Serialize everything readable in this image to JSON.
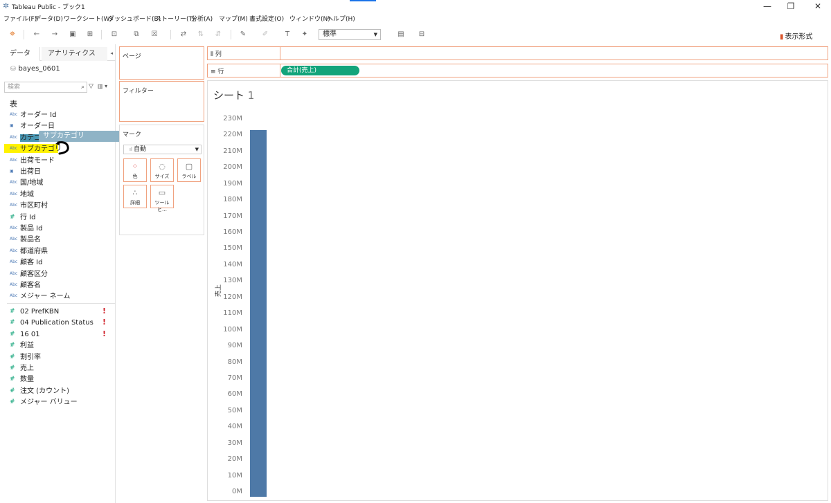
{
  "window": {
    "title": "Tableau Public - ブック1",
    "controls": [
      "—",
      "❐",
      "✕"
    ]
  },
  "menu": [
    "ファイル(F)",
    "データ(D)",
    "ワークシート(W)",
    "ダッシュボード(B)",
    "ストーリー(T)",
    "分析(A)",
    "マップ(M)",
    "書式設定(O)",
    "ウィンドウ(N)",
    "ヘルプ(H)"
  ],
  "toolbar": {
    "fit_value": "標準",
    "show_me_label": "表示形式"
  },
  "data_pane": {
    "tab_data": "データ",
    "tab_analytics": "アナリティクス",
    "datasource": "bayes_0601",
    "search_placeholder": "検索",
    "section_title": "表",
    "dimensions": [
      {
        "type": "Abc",
        "label": "オーダー Id"
      },
      {
        "type": "date",
        "label": "オーダー日"
      },
      {
        "type": "Abc",
        "label": "カテゴリ"
      },
      {
        "type": "Abc",
        "label": "サブカテゴリ"
      },
      {
        "type": "Abc",
        "label": "出荷モード"
      },
      {
        "type": "date",
        "label": "出荷日"
      },
      {
        "type": "Abc",
        "label": "国/地域"
      },
      {
        "type": "Abc",
        "label": "地域"
      },
      {
        "type": "Abc",
        "label": "市区町村"
      },
      {
        "type": "#",
        "label": "行 Id"
      },
      {
        "type": "Abc",
        "label": "製品 Id"
      },
      {
        "type": "Abc",
        "label": "製品名"
      },
      {
        "type": "Abc",
        "label": "都道府県"
      },
      {
        "type": "Abc",
        "label": "顧客 Id"
      },
      {
        "type": "Abc",
        "label": "顧客区分"
      },
      {
        "type": "Abc",
        "label": "顧客名"
      },
      {
        "type": "Abc",
        "label": "メジャー ネーム"
      }
    ],
    "measures": [
      {
        "type": "#",
        "label": "02 PrefKBN",
        "warning": true
      },
      {
        "type": "#",
        "label": "04 Publication Status",
        "warning": true
      },
      {
        "type": "#",
        "label": "16 01",
        "warning": true
      },
      {
        "type": "#",
        "label": "利益"
      },
      {
        "type": "#",
        "label": "割引率"
      },
      {
        "type": "#",
        "label": "売上"
      },
      {
        "type": "#",
        "label": "数量"
      },
      {
        "type": "#",
        "label": "注文 (カウント)"
      },
      {
        "type": "#",
        "label": "メジャー バリュー"
      }
    ],
    "drag_ghost": "サブカテゴリ",
    "warning_mark": "!"
  },
  "cards": {
    "pages_title": "ページ",
    "filters_title": "フィルター",
    "marks_title": "マーク",
    "marks_type": "自動",
    "marks_buttons": [
      {
        "icon": "color-icon",
        "label": "色"
      },
      {
        "icon": "size-icon",
        "label": "サイズ"
      },
      {
        "icon": "label-icon",
        "label": "ラベル"
      },
      {
        "icon": "detail-icon",
        "label": "詳細"
      },
      {
        "icon": "tooltip-icon",
        "label": "ツールヒ…"
      }
    ]
  },
  "shelves": {
    "columns_label": "列",
    "rows_label": "行",
    "rows_pill": "合計(売上)"
  },
  "sheet": {
    "title_text": "シート",
    "title_number": "1"
  },
  "chart_data": {
    "type": "bar",
    "categories": [
      ""
    ],
    "values": [
      226000000
    ],
    "title": "",
    "xlabel": "",
    "ylabel": "売上",
    "ylim": [
      0,
      230000000
    ],
    "yticks": [
      "230M",
      "220M",
      "210M",
      "200M",
      "190M",
      "180M",
      "170M",
      "160M",
      "150M",
      "140M",
      "130M",
      "120M",
      "110M",
      "100M",
      "90M",
      "80M",
      "70M",
      "60M",
      "50M",
      "40M",
      "30M",
      "20M",
      "10M",
      "0M"
    ],
    "bar_color": "#4e79a7",
    "grid": false
  }
}
